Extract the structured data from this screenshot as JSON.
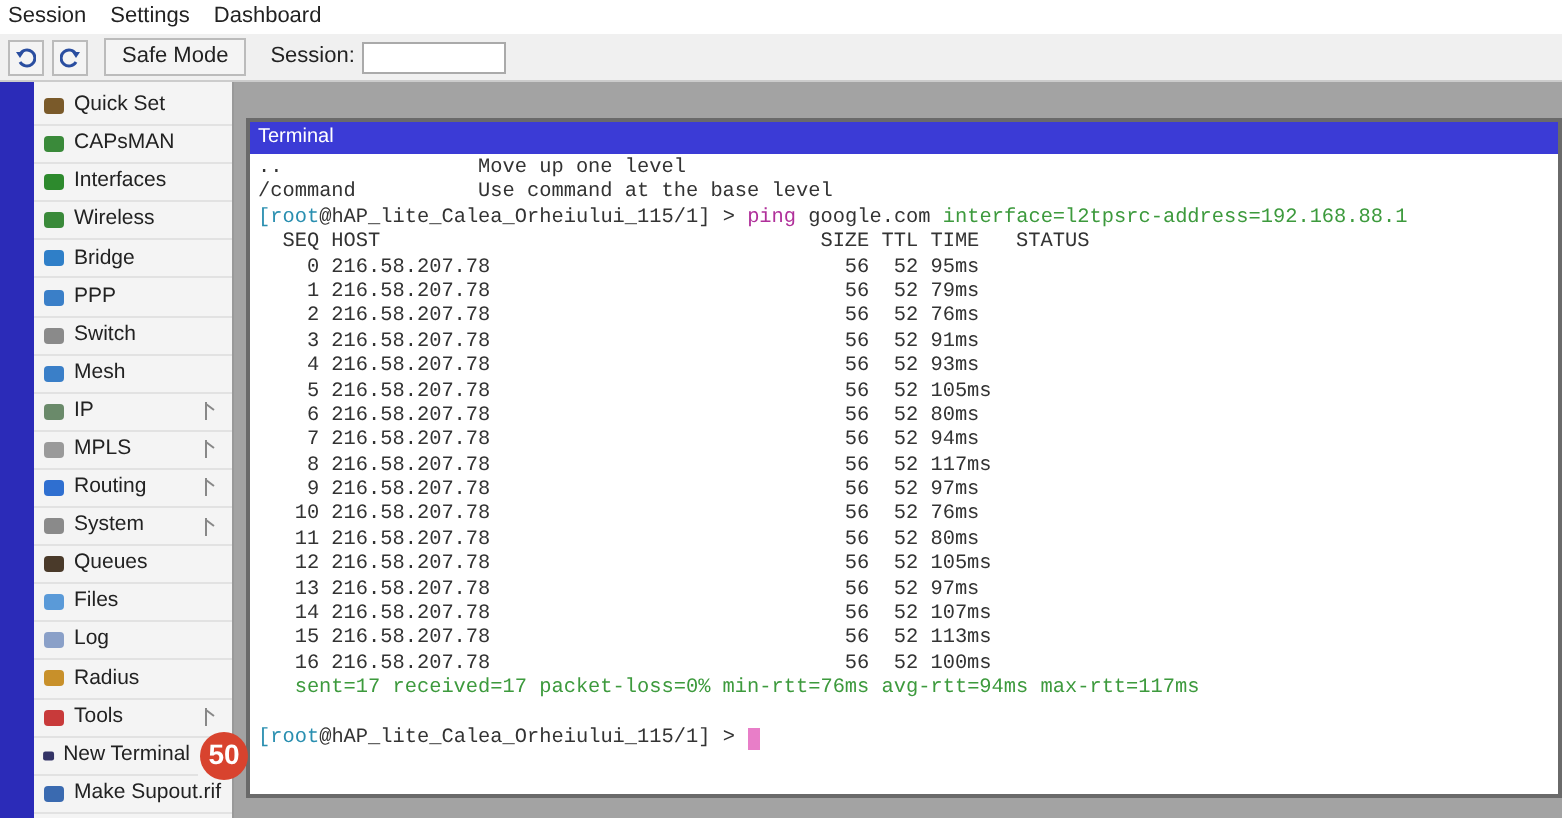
{
  "menu": [
    "Session",
    "Settings",
    "Dashboard"
  ],
  "toolbar": {
    "safe_mode": "Safe Mode",
    "session_label": "Session:"
  },
  "sidebar": {
    "items": [
      {
        "label": "Quick Set",
        "submenu": false
      },
      {
        "label": "CAPsMAN",
        "submenu": false
      },
      {
        "label": "Interfaces",
        "submenu": false
      },
      {
        "label": "Wireless",
        "submenu": false
      },
      {
        "label": "Bridge",
        "submenu": false
      },
      {
        "label": "PPP",
        "submenu": false
      },
      {
        "label": "Switch",
        "submenu": false
      },
      {
        "label": "Mesh",
        "submenu": false
      },
      {
        "label": "IP",
        "submenu": true
      },
      {
        "label": "MPLS",
        "submenu": true
      },
      {
        "label": "Routing",
        "submenu": true
      },
      {
        "label": "System",
        "submenu": true
      },
      {
        "label": "Queues",
        "submenu": false
      },
      {
        "label": "Files",
        "submenu": false
      },
      {
        "label": "Log",
        "submenu": false
      },
      {
        "label": "Radius",
        "submenu": false
      },
      {
        "label": "Tools",
        "submenu": true
      },
      {
        "label": "New Terminal",
        "submenu": false,
        "badge": "50"
      },
      {
        "label": "Make Supout.rif",
        "submenu": false
      }
    ]
  },
  "terminal": {
    "title": "Terminal",
    "lines": [
      {
        "kind": "help",
        "key": "..",
        "text": "Move up one level"
      },
      {
        "kind": "help",
        "key": "/command",
        "text": "Use command at the base level"
      },
      {
        "kind": "prompt",
        "segments": [
          {
            "text": "[root",
            "color": "#2a8fb0"
          },
          {
            "text": "@hAP_lite_Calea_Orheiului_115/1] > ",
            "color": "#333333"
          },
          {
            "text": "ping",
            "color": "#b0309a"
          },
          {
            "text": " google.com ",
            "color": "#333333"
          },
          {
            "text": "interface=l2tp",
            "color": "#3d9a3d"
          },
          {
            "text": "src-address=192.168.88.1",
            "color": "#3d9a3d"
          }
        ]
      },
      {
        "kind": "header",
        "seq": "SEQ",
        "host": "HOST",
        "size": "SIZE",
        "ttl": "TTL",
        "time": "TIME",
        "status": "STATUS"
      },
      {
        "kind": "row",
        "seq": "0",
        "host": "216.58.207.78",
        "size": "56",
        "ttl": "52",
        "time": "95ms"
      },
      {
        "kind": "row",
        "seq": "1",
        "host": "216.58.207.78",
        "size": "56",
        "ttl": "52",
        "time": "79ms"
      },
      {
        "kind": "row",
        "seq": "2",
        "host": "216.58.207.78",
        "size": "56",
        "ttl": "52",
        "time": "76ms"
      },
      {
        "kind": "row",
        "seq": "3",
        "host": "216.58.207.78",
        "size": "56",
        "ttl": "52",
        "time": "91ms"
      },
      {
        "kind": "row",
        "seq": "4",
        "host": "216.58.207.78",
        "size": "56",
        "ttl": "52",
        "time": "93ms"
      },
      {
        "kind": "row",
        "seq": "5",
        "host": "216.58.207.78",
        "size": "56",
        "ttl": "52",
        "time": "105ms"
      },
      {
        "kind": "row",
        "seq": "6",
        "host": "216.58.207.78",
        "size": "56",
        "ttl": "52",
        "time": "80ms"
      },
      {
        "kind": "row",
        "seq": "7",
        "host": "216.58.207.78",
        "size": "56",
        "ttl": "52",
        "time": "94ms"
      },
      {
        "kind": "row",
        "seq": "8",
        "host": "216.58.207.78",
        "size": "56",
        "ttl": "52",
        "time": "117ms"
      },
      {
        "kind": "row",
        "seq": "9",
        "host": "216.58.207.78",
        "size": "56",
        "ttl": "52",
        "time": "97ms"
      },
      {
        "kind": "row",
        "seq": "10",
        "host": "216.58.207.78",
        "size": "56",
        "ttl": "52",
        "time": "76ms"
      },
      {
        "kind": "row",
        "seq": "11",
        "host": "216.58.207.78",
        "size": "56",
        "ttl": "52",
        "time": "80ms"
      },
      {
        "kind": "row",
        "seq": "12",
        "host": "216.58.207.78",
        "size": "56",
        "ttl": "52",
        "time": "105ms"
      },
      {
        "kind": "row",
        "seq": "13",
        "host": "216.58.207.78",
        "size": "56",
        "ttl": "52",
        "time": "97ms"
      },
      {
        "kind": "row",
        "seq": "14",
        "host": "216.58.207.78",
        "size": "56",
        "ttl": "52",
        "time": "107ms"
      },
      {
        "kind": "row",
        "seq": "15",
        "host": "216.58.207.78",
        "size": "56",
        "ttl": "52",
        "time": "113ms"
      },
      {
        "kind": "row",
        "seq": "16",
        "host": "216.58.207.78",
        "size": "56",
        "ttl": "52",
        "time": "100ms"
      },
      {
        "kind": "summary",
        "text": "sent=17 received=17 packet-loss=0% min-rtt=76ms avg-rtt=94ms max-rtt=117ms"
      },
      {
        "kind": "blank"
      },
      {
        "kind": "prompt",
        "cursor": true,
        "segments": [
          {
            "text": "[root",
            "color": "#2a8fb0"
          },
          {
            "text": "@hAP_lite_Calea_Orheiului_115/1] > ",
            "color": "#333333"
          }
        ]
      }
    ]
  }
}
